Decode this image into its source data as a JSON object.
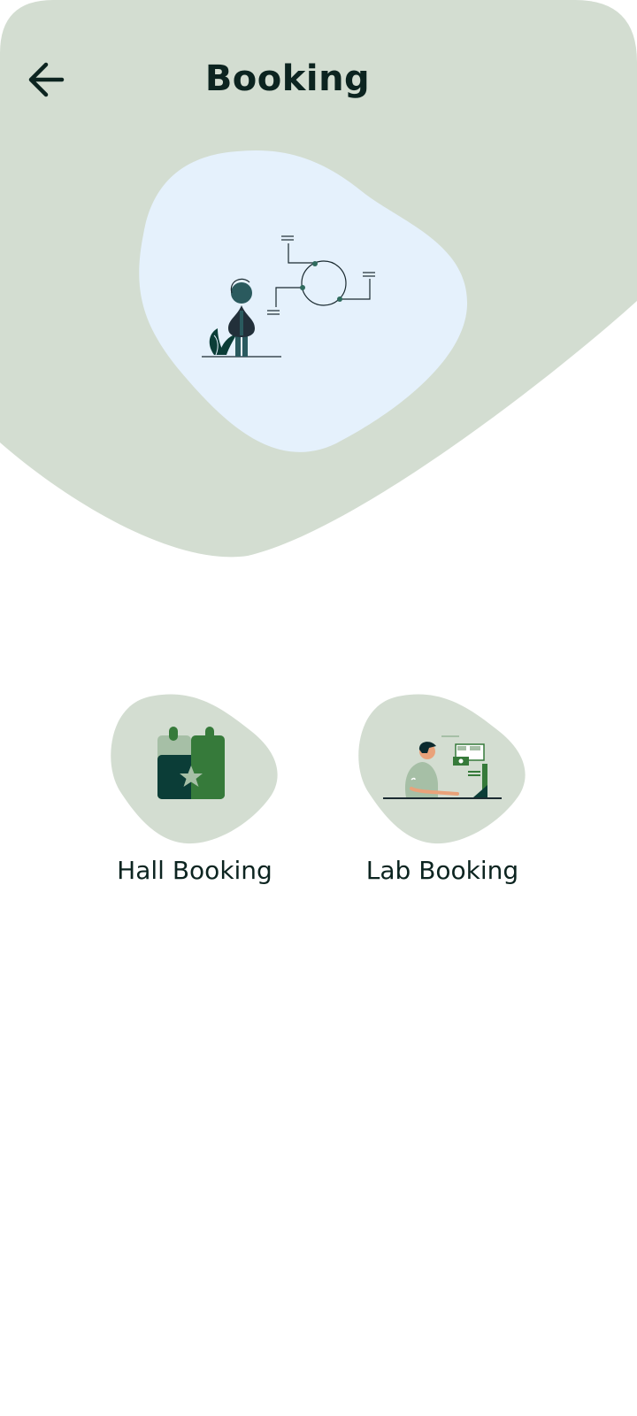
{
  "header": {
    "title": "Booking",
    "back_icon": "arrow-left-icon"
  },
  "hero": {
    "illustration": "person-with-process-diagram-illustration"
  },
  "options": [
    {
      "label": "Hall Booking",
      "icon": "calendar-star-icon"
    },
    {
      "label": "Lab Booking",
      "icon": "person-at-computer-illustration"
    }
  ],
  "colors": {
    "background": "#ffffff",
    "header_blob": "#d3ddd1",
    "hero_blob": "#e5f1fc",
    "option_blob": "#d3ddd1",
    "text": "#0c2420",
    "dark_green": "#0b3d37",
    "accent_green": "#367a3a",
    "light_green": "#a6bfa6"
  }
}
